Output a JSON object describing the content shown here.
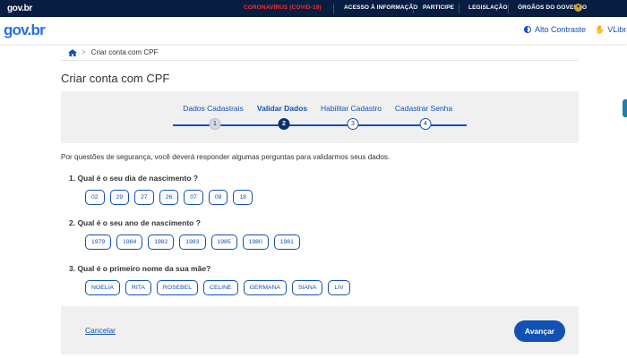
{
  "topbar": {
    "brand": "gov.br",
    "covid": "CORONAVÍRUS (COVID-19)",
    "links": [
      "ACESSO À INFORMAÇÃO",
      "PARTICIPE",
      "LEGISLAÇÃO",
      "ÓRGÃOS DO GOVERNO"
    ]
  },
  "header": {
    "logo": "gov.br",
    "high_contrast": "Alto Contraste",
    "vlibras": "VLibras"
  },
  "breadcrumb": {
    "current": "Criar conta com CPF"
  },
  "page_title": "Criar conta com CPF",
  "stepper": {
    "steps": [
      {
        "label": "Dados Cadastrais",
        "number": "1",
        "state": "done"
      },
      {
        "label": "Validar Dados",
        "number": "2",
        "state": "active"
      },
      {
        "label": "Habilitar Cadastro",
        "number": "3",
        "state": "pending"
      },
      {
        "label": "Cadastrar Senha",
        "number": "4",
        "state": "pending"
      }
    ]
  },
  "intro": "Por questões de segurança, você deverá responder algumas perguntas para validarmos seus dados.",
  "questions": [
    {
      "label": "1.  Qual é o seu dia de nascimento ?",
      "options": [
        "02",
        "29",
        "27",
        "26",
        "07",
        "09",
        "18"
      ]
    },
    {
      "label": "2.  Qual é o seu ano de nascimento ?",
      "options": [
        "1979",
        "1984",
        "1982",
        "1983",
        "1985",
        "1980",
        "1981"
      ]
    },
    {
      "label": "3.  Qual é o primeiro nome da sua mãe?",
      "options": [
        "NOELIA",
        "RITA",
        "ROSEBEL",
        "CELINE",
        "GERMANA",
        "SIANA",
        "LIV"
      ]
    }
  ],
  "footer": {
    "cancel": "Cancelar",
    "advance": "Avançar"
  },
  "colors": {
    "topbar": "#071d41",
    "primary": "#1351b4",
    "covid": "#ff2d2d"
  }
}
